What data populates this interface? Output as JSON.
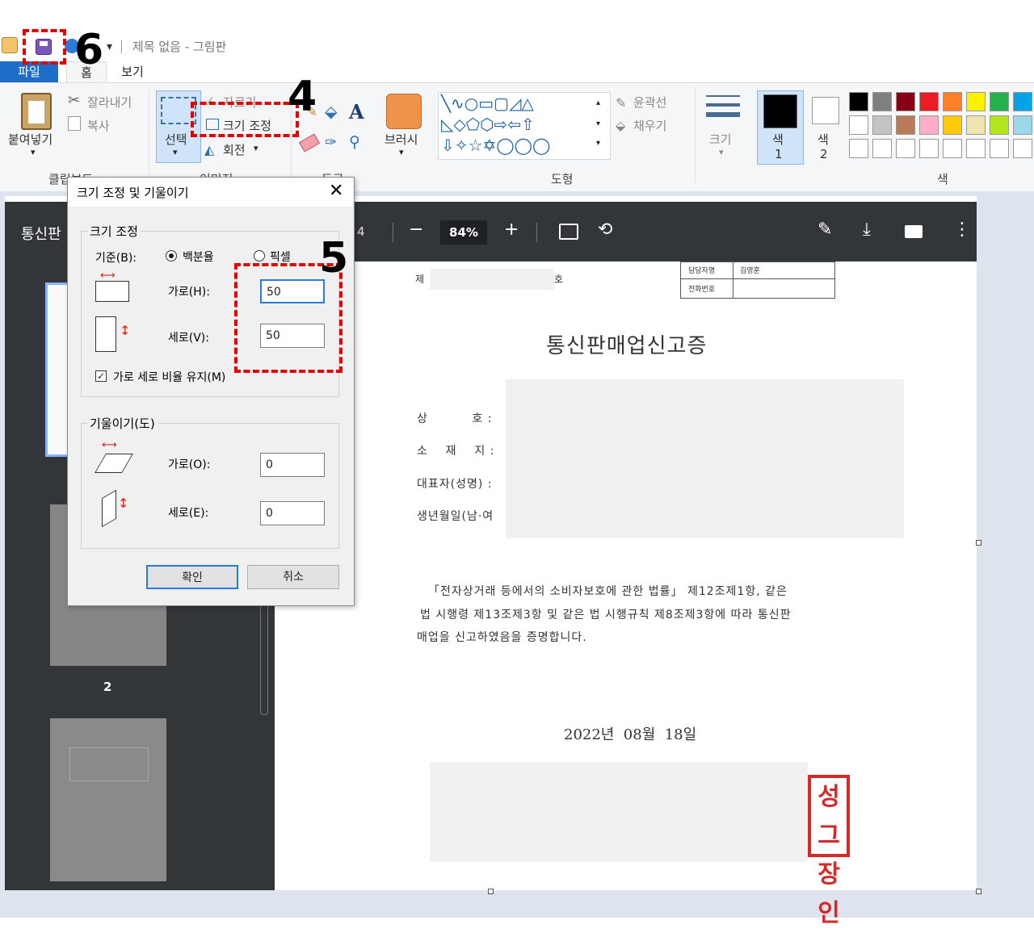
{
  "window": {
    "title": "제목 없음 - 그림판"
  },
  "menu": {
    "file": "파일",
    "home": "홈",
    "view": "보기"
  },
  "ribbon": {
    "clipboard": {
      "paste": "붙여넣기",
      "cut": "잘라내기",
      "copy": "복사",
      "group_label": "클립보드"
    },
    "image": {
      "select": "선택",
      "crop": "자르기",
      "resize": "크기 조정",
      "rotate": "회전",
      "group_label": "이미지"
    },
    "tools": {
      "group_label": "도구",
      "text_tool": "A"
    },
    "brush": {
      "label": "브러시"
    },
    "shapes": {
      "outline": "윤곽선",
      "fill": "채우기",
      "group_label": "도형"
    },
    "size": {
      "label": "크기"
    },
    "colors": {
      "color1": "색\n1",
      "color1_a": "색",
      "color1_b": "1",
      "color2_a": "색",
      "color2_b": "2",
      "group_label": "색",
      "palette_row1": [
        "#000000",
        "#7f7f7f",
        "#880015",
        "#ed1c24",
        "#ff7f27",
        "#fff200",
        "#22b14c",
        "#00a2e8"
      ],
      "palette_row2": [
        "#ffffff",
        "#c3c3c3",
        "#b97a57",
        "#ffaec9",
        "#ffc90e",
        "#efe4b0",
        "#b5e61d",
        "#99d9ea"
      ]
    }
  },
  "pdf": {
    "title": "통신판",
    "page_num": "4",
    "zoom": "84%",
    "thumb_page_label": "2"
  },
  "document": {
    "no_prefix": "제",
    "no_suffix": "호",
    "contact": {
      "manager_label": "담당자명",
      "manager_value": "김영훈",
      "phone_label": "전화번호"
    },
    "heading": "통신판매업신고증",
    "field_trade_name": "상          호 :",
    "field_address": "소    재    지 :",
    "field_rep": "대표자(성명) :",
    "field_birth": "생년월일(남·여",
    "body_line1": "「전자상거래 등에서의 소비자보호에 관한 법률」 제12조제1항, 같은",
    "body_line2": "법 시행령 제13조제3항 및 같은 법 시행규칙 제8조제3항에 따라 통신판",
    "body_line3": "매업을 신고하였음을 증명합니다.",
    "date": "2022년  08월  18일",
    "stamp_line1": "성그",
    "stamp_line2": "장인"
  },
  "dialog": {
    "title": "크기 조정 및 기울이기",
    "resize_legend": "크기 조정",
    "basis_label": "기준(B):",
    "percent_label": "백분율",
    "pixel_label": "픽셀",
    "horizontal_label": "가로(H):",
    "horizontal_value": "50",
    "vertical_label": "세로(V):",
    "vertical_value": "50",
    "keep_ratio_label": "가로 세로 비율 유지(M)",
    "skew_legend": "기울이기(도)",
    "skew_h_label": "가로(O):",
    "skew_h_value": "0",
    "skew_v_label": "세로(E):",
    "skew_v_value": "0",
    "ok": "확인",
    "cancel": "취소"
  },
  "annotations": {
    "step4": "4",
    "step5": "5",
    "step6": "6"
  }
}
